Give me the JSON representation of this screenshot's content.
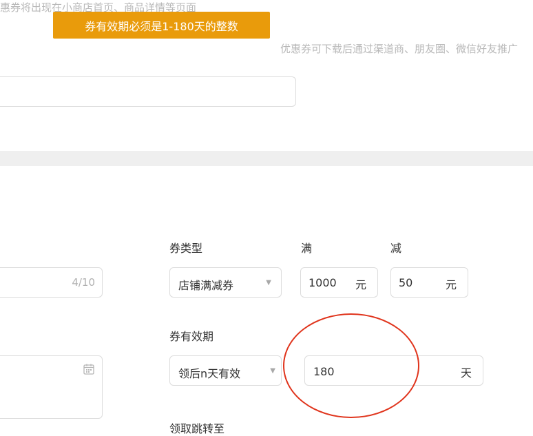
{
  "hints": {
    "top_text": "惠券将出现在小商店首页、商品详情等页面",
    "promo_text": "优惠券可下载后通过渠道商、朋友圈、微信好友推广"
  },
  "toast": {
    "message": "券有效期必须是1-180天的整数"
  },
  "name_field": {
    "counter": "4/10"
  },
  "coupon_type": {
    "label": "券类型",
    "selected": "店铺满减券"
  },
  "threshold": {
    "label": "满",
    "value": "1000",
    "unit": "元"
  },
  "discount": {
    "label": "减",
    "value": "50",
    "unit": "元"
  },
  "validity": {
    "label": "券有效期",
    "mode_selected": "领后n天有效",
    "days_value": "180",
    "days_unit": "天"
  },
  "redirect": {
    "label": "领取跳转至"
  },
  "colors": {
    "toast_bg": "#e99b0b",
    "annotation_circle": "#e0341c"
  }
}
